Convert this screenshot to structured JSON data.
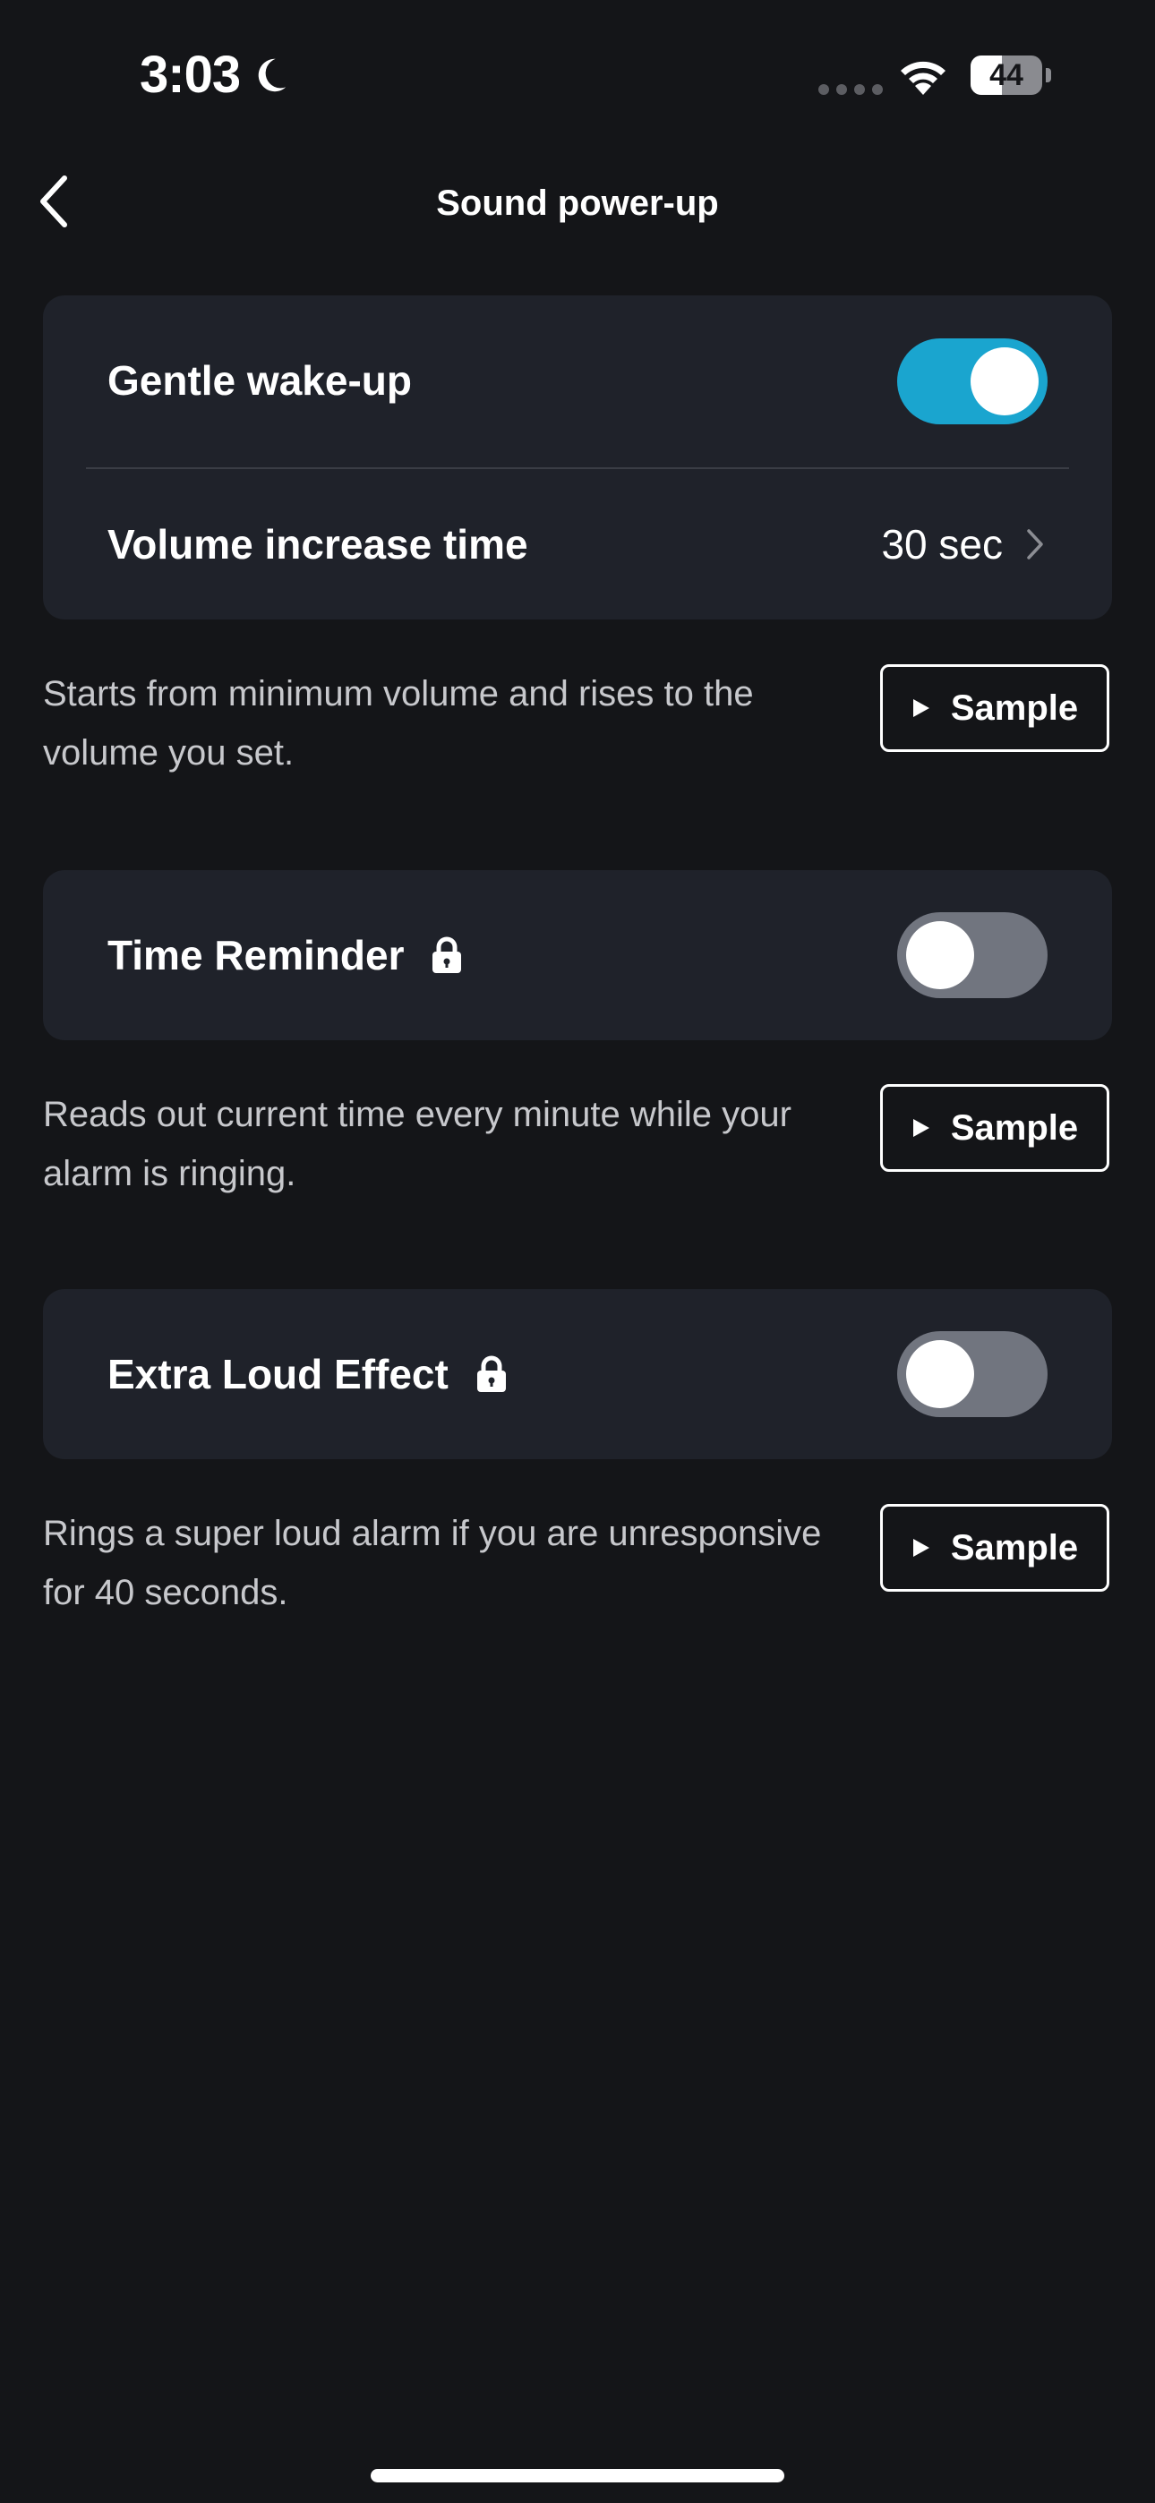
{
  "status_bar": {
    "time": "3:03",
    "battery_level": "44",
    "battery_fraction": 0.44,
    "moon_icon": "moon-icon",
    "wifi_icon": "wifi-icon"
  },
  "nav": {
    "title": "Sound power-up",
    "back_icon": "chevron-left-icon"
  },
  "gentle_wakeup": {
    "label": "Gentle wake-up",
    "enabled": true,
    "volume_label": "Volume increase time",
    "volume_value": "30 sec",
    "description": "Starts from minimum volume and rises to the volume you set.",
    "sample_label": "Sample"
  },
  "time_reminder": {
    "label": "Time Reminder",
    "locked": true,
    "enabled": false,
    "description": "Reads out current time every minute while your alarm is ringing.",
    "sample_label": "Sample"
  },
  "extra_loud": {
    "label": "Extra Loud Effect",
    "locked": true,
    "enabled": false,
    "description": "Rings a super loud alarm if you are unresponsive for 40 seconds.",
    "sample_label": "Sample"
  },
  "colors": {
    "background": "#141518",
    "card": "#1f222a",
    "toggle_on": "#1aa5cf",
    "toggle_off": "#71757f"
  }
}
